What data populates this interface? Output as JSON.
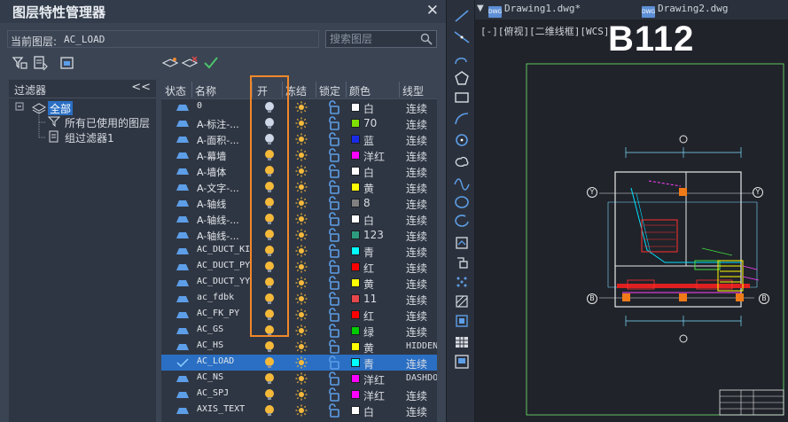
{
  "panel": {
    "title": "图层特性管理器",
    "close_glyph": "✕",
    "current_layer_label": "当前图层:",
    "current_layer_value": "AC_LOAD",
    "search_placeholder": "搜索图层"
  },
  "filters": {
    "title": "过滤器",
    "collapse_glyph": "<<",
    "items": [
      {
        "label": "全部",
        "selected": true
      },
      {
        "label": "所有已使用的图层"
      },
      {
        "label": "组过滤器1"
      }
    ]
  },
  "table": {
    "columns": [
      "状态",
      "名称",
      "开",
      "冻结",
      "锁定",
      "颜色",
      "线型"
    ],
    "rows": [
      {
        "name": "0",
        "on": false,
        "color": "#ffffff",
        "color_name": "白",
        "linetype": "连续"
      },
      {
        "name": "A-标注-...",
        "on": false,
        "color": "#7fe000",
        "color_name": "70",
        "linetype": "连续"
      },
      {
        "name": "A-面积-...",
        "on": false,
        "color": "#1a2be8",
        "color_name": "蓝",
        "linetype": "连续"
      },
      {
        "name": "A-幕墙",
        "on": true,
        "color": "#ff00ff",
        "color_name": "洋红",
        "linetype": "连续"
      },
      {
        "name": "A-墙体",
        "on": true,
        "color": "#ffffff",
        "color_name": "白",
        "linetype": "连续"
      },
      {
        "name": "A-文字-...",
        "on": true,
        "color": "#ffff00",
        "color_name": "黄",
        "linetype": "连续"
      },
      {
        "name": "A-轴线",
        "on": true,
        "color": "#808080",
        "color_name": "8",
        "linetype": "连续"
      },
      {
        "name": "A-轴线-...",
        "on": true,
        "color": "#ffffff",
        "color_name": "白",
        "linetype": "连续"
      },
      {
        "name": "A-轴线-...",
        "on": true,
        "color": "#2e9c7e",
        "color_name": "123",
        "linetype": "连续"
      },
      {
        "name": "AC_DUCT_KI",
        "on": true,
        "color": "#00ffff",
        "color_name": "青",
        "linetype": "连续"
      },
      {
        "name": "AC_DUCT_PY",
        "on": true,
        "color": "#ff0000",
        "color_name": "红",
        "linetype": "连续"
      },
      {
        "name": "AC_DUCT_YY",
        "on": true,
        "color": "#ffff00",
        "color_name": "黄",
        "linetype": "连续"
      },
      {
        "name": "ac_fdbk",
        "on": true,
        "color": "#e6474a",
        "color_name": "11",
        "linetype": "连续"
      },
      {
        "name": "AC_FK_PY",
        "on": true,
        "color": "#ff0000",
        "color_name": "红",
        "linetype": "连续"
      },
      {
        "name": "AC_GS",
        "on": true,
        "color": "#00cc00",
        "color_name": "绿",
        "linetype": "连续"
      },
      {
        "name": "AC_HS",
        "on": true,
        "color": "#ffff00",
        "color_name": "黄",
        "linetype": "HIDDEN"
      },
      {
        "name": "AC_LOAD",
        "on": true,
        "color": "#00ffff",
        "color_name": "青",
        "linetype": "连续",
        "current": true
      },
      {
        "name": "AC_NS",
        "on": true,
        "color": "#ff00ff",
        "color_name": "洋红",
        "linetype": "DASHDOT"
      },
      {
        "name": "AC_SPJ",
        "on": true,
        "color": "#ff00ff",
        "color_name": "洋红",
        "linetype": "连续"
      },
      {
        "name": "AXIS_TEXT",
        "on": true,
        "color": "#ffffff",
        "color_name": "白",
        "linetype": "连续"
      }
    ]
  },
  "canvas": {
    "tabs": [
      {
        "label": "Drawing1.dwg*"
      },
      {
        "label": "Drawing2.dwg"
      }
    ],
    "tab_icon_text": "DWG",
    "viewport_controls": "[-][俯视][二维线框][WCS]",
    "big_label": "B112",
    "axis_labels": [
      "Y",
      "Y",
      "B",
      "B"
    ]
  },
  "colors": {
    "accent": "#2a6fc4",
    "highlight": "#f0882a",
    "bulb_on": "#f5b93a",
    "bulb_off": "#cfd8e8",
    "icon_blue": "#5d9ee8"
  }
}
